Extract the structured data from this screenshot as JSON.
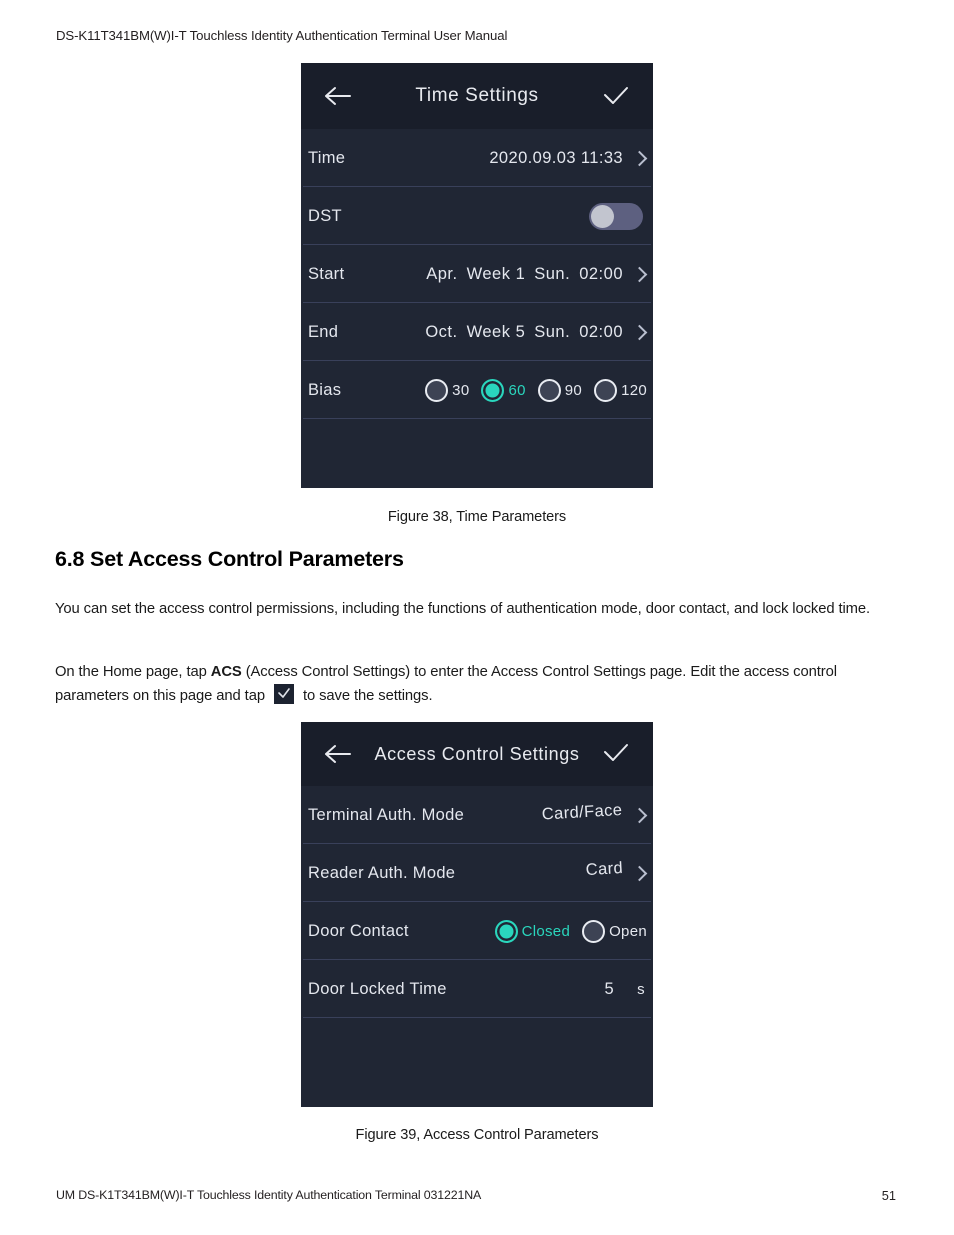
{
  "page": {
    "header": "DS-K11T341BM(W)I-T Touchless Identity Authentication Terminal User Manual",
    "footer": "UM DS-K1T341BM(W)I-T Touchless Identity Authentication Terminal 031221NA",
    "page_number": "51"
  },
  "figure_38": {
    "caption": "Figure 38, Time Parameters",
    "screen": {
      "title": "Time Settings",
      "back_icon": "arrow-left-icon",
      "save_icon": "checkmark-icon",
      "rows": [
        {
          "label": "Time",
          "value": "2020.09.03 11:33",
          "control": "chevron"
        },
        {
          "label": "DST",
          "control": "toggle",
          "toggle_state": "off"
        },
        {
          "label": "Start",
          "segments": [
            "Apr.",
            "Week 1",
            "Sun.",
            "02:00"
          ],
          "control": "chevron"
        },
        {
          "label": "End",
          "segments": [
            "Oct.",
            "Week 5",
            "Sun.",
            "02:00"
          ],
          "control": "chevron"
        },
        {
          "label": "Bias",
          "control": "radio",
          "options": [
            {
              "label": "30",
              "selected": false
            },
            {
              "label": "60",
              "selected": true
            },
            {
              "label": "90",
              "selected": false
            },
            {
              "label": "120",
              "selected": false
            }
          ]
        }
      ]
    }
  },
  "section": {
    "heading": "6.8 Set Access Control Parameters",
    "paragraph_1": "You can set the access control permissions, including the functions of authentication mode, door contact, and lock locked time.",
    "paragraph_2": {
      "part_1": "On the Home page, tap ",
      "bold": "ACS",
      "part_2": " (Access Control Settings) to enter the Access Control Settings page. Edit the access control parameters on this page and tap ",
      "inline_icon": "checkmark-box-icon",
      "part_3": " to save the settings."
    }
  },
  "figure_39": {
    "caption": "Figure 39, Access Control Parameters",
    "screen": {
      "title": "Access Control Settings",
      "back_icon": "arrow-left-icon",
      "save_icon": "checkmark-icon",
      "rows": [
        {
          "label": "Terminal Auth. Mode",
          "value": "Card/Face",
          "control": "chevron"
        },
        {
          "label": "Reader Auth. Mode",
          "value": "Card",
          "control": "chevron"
        },
        {
          "label": "Door Contact",
          "control": "radio",
          "options": [
            {
              "label": "Closed",
              "selected": true
            },
            {
              "label": "Open",
              "selected": false
            }
          ]
        },
        {
          "label": "Door Locked Time",
          "value": "5",
          "unit": "s",
          "control": "value"
        }
      ]
    }
  },
  "colors": {
    "screen_bg": "#202634",
    "topbar_bg": "#191e2a",
    "accent_teal": "#2ad6bd",
    "divider": "#39405a",
    "text_light": "#e4e7ee"
  }
}
